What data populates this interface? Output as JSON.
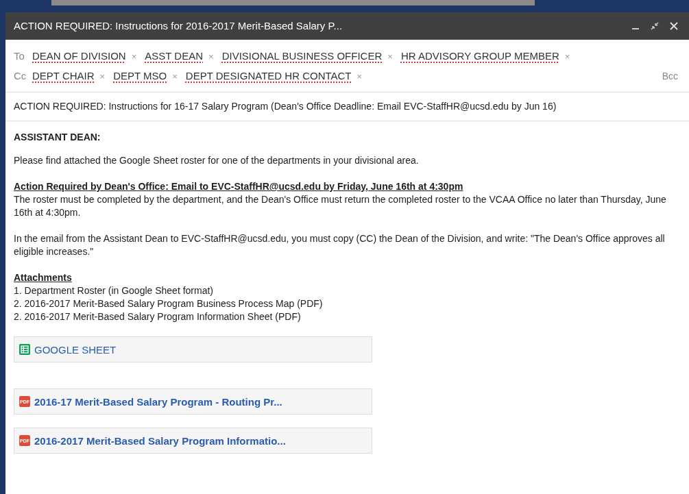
{
  "window": {
    "title": "ACTION REQUIRED: Instructions for 2016-2017 Merit-Based Salary P..."
  },
  "recipients": {
    "to_label": "To",
    "to": [
      "DEAN OF DIVISION",
      "ASST DEAN",
      "DIVISIONAL BUSINESS OFFICER",
      "HR ADVISORY GROUP MEMBER"
    ],
    "cc_label": "Cc",
    "cc": [
      "DEPT CHAIR",
      "DEPT MSO",
      "DEPT DESIGNATED HR CONTACT"
    ],
    "bcc": "Bcc",
    "remove_mark": "×"
  },
  "subject": "ACTION REQUIRED: Instructions for 16-17 Salary Program (Dean's Office Deadline: Email EVC-StaffHR@ucsd.edu by Jun 16)",
  "body": [
    {
      "kind": "heading",
      "text": "ASSISTANT DEAN:"
    },
    {
      "kind": "paragraph",
      "lines": [
        "Please find attached the Google Sheet roster for one of the departments in your divisional area."
      ]
    },
    {
      "kind": "paragraph",
      "lines": [
        "**Action Required by Dean's Office: Email to EVC-StaffHR@ucsd.edu by Friday, June 16th at 4:30pm**",
        "The roster must be completed by the department, and the Dean's Office must return the completed roster to the VCAA Office no later than Thursday, June 16th at 4:30pm."
      ]
    },
    {
      "kind": "paragraph",
      "lines": [
        "In the email from the Assistant Dean to EVC-StaffHR@ucsd.edu, you must copy (CC) the Dean of the Division, and write: \"The Dean's Office approves all eligible increases.\""
      ]
    },
    {
      "kind": "paragraph",
      "lines": [
        "**Attachments**",
        "1. Department Roster (in Google Sheet format)",
        "2. 2016-2017 Merit-Based Salary Program Business Process Map (PDF)",
        "2. 2016-2017 Merit-Based Salary Program Information Sheet (PDF)"
      ]
    }
  ],
  "attachments": [
    {
      "kind": "sheet",
      "name": "GOOGLE SHEET"
    },
    {
      "kind": "pdf",
      "badge": "PDF",
      "name": "2016-17 Merit-Based Salary Program - Routing Pr..."
    },
    {
      "kind": "pdf",
      "badge": "PDF",
      "name": "2016-2017 Merit-Based Salary Program Informatio..."
    }
  ]
}
